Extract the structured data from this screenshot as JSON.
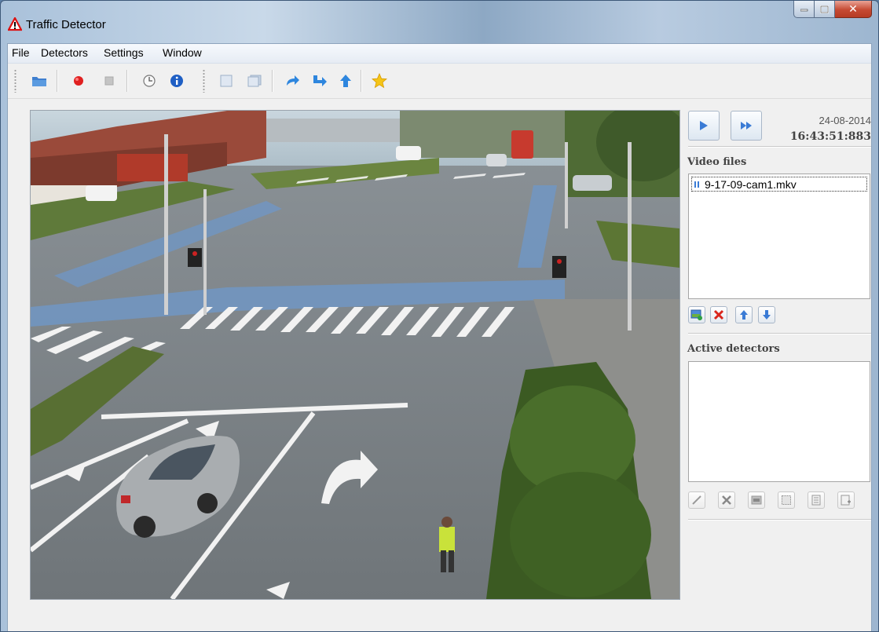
{
  "window": {
    "title": "Traffic Detector"
  },
  "menu": [
    {
      "label": "File"
    },
    {
      "label": "Detectors"
    },
    {
      "label": "Settings"
    },
    {
      "label": "Window"
    }
  ],
  "toolbar": {
    "buttons": [
      "open-folder-icon",
      "record-icon",
      "stop-icon",
      "clock-icon",
      "info-icon",
      "frame-icon",
      "layers-icon",
      "redo-icon",
      "forward-arrow-icon",
      "up-arrow-icon",
      "star-icon"
    ]
  },
  "playback": {
    "date": "24-08-2014",
    "time": "16:43:51:883"
  },
  "video_files": {
    "title": "Video files",
    "items": [
      {
        "name": "9-17-09-cam1.mkv"
      }
    ]
  },
  "active_detectors": {
    "title": "Active detectors",
    "items": []
  },
  "colors": {
    "accent_blue": "#3a7bd5",
    "record_red": "#e02020",
    "delete_red": "#d9261c",
    "info_blue": "#1f5fc4",
    "star_yellow": "#f5c518"
  }
}
